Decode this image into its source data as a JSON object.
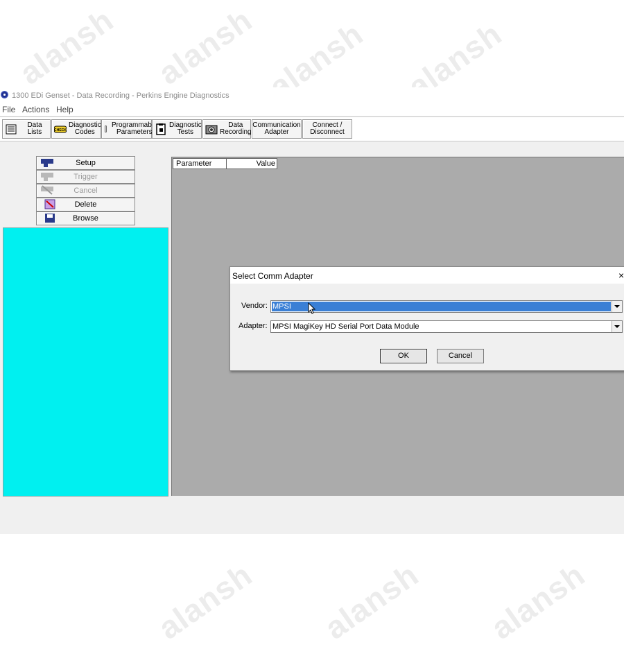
{
  "window": {
    "title": "1300 EDi Genset - Data Recording - Perkins Engine Diagnostics"
  },
  "menu": [
    "File",
    "Actions",
    "Help"
  ],
  "toolbar": [
    {
      "label": "Data Lists",
      "icon": "data-lists-icon"
    },
    {
      "label": "Diagnostic\nCodes",
      "icon": "check-engine-icon"
    },
    {
      "label": "Programmable\nParameters",
      "icon": "wrench-icon"
    },
    {
      "label": "Diagnostic\nTests",
      "icon": "clipboard-icon"
    },
    {
      "label": "Data\nRecording",
      "icon": "camera-icon"
    },
    {
      "label": "Communication\nAdapter",
      "icon": ""
    },
    {
      "label": "Connect /\nDisconnect",
      "icon": ""
    }
  ],
  "recording_buttons": [
    {
      "label": "Setup",
      "disabled": false,
      "icon": "setup-icon"
    },
    {
      "label": "Trigger",
      "disabled": true,
      "icon": "trigger-icon"
    },
    {
      "label": "Cancel",
      "disabled": true,
      "icon": "cancel-icon"
    },
    {
      "label": "Delete",
      "disabled": false,
      "icon": "delete-icon"
    },
    {
      "label": "Browse",
      "disabled": false,
      "icon": "floppy-disk-icon"
    }
  ],
  "table": {
    "columns": [
      "Parameter",
      "Value"
    ]
  },
  "dialog": {
    "title": "Select Comm Adapter",
    "close": "×",
    "vendor_label": "Vendor:",
    "vendor_value": "MPSI",
    "adapter_label": "Adapter:",
    "adapter_value": "MPSI MagiKey HD Serial Port Data Module",
    "ok_label": "OK",
    "cancel_label": "Cancel"
  },
  "watermark": "alansh"
}
